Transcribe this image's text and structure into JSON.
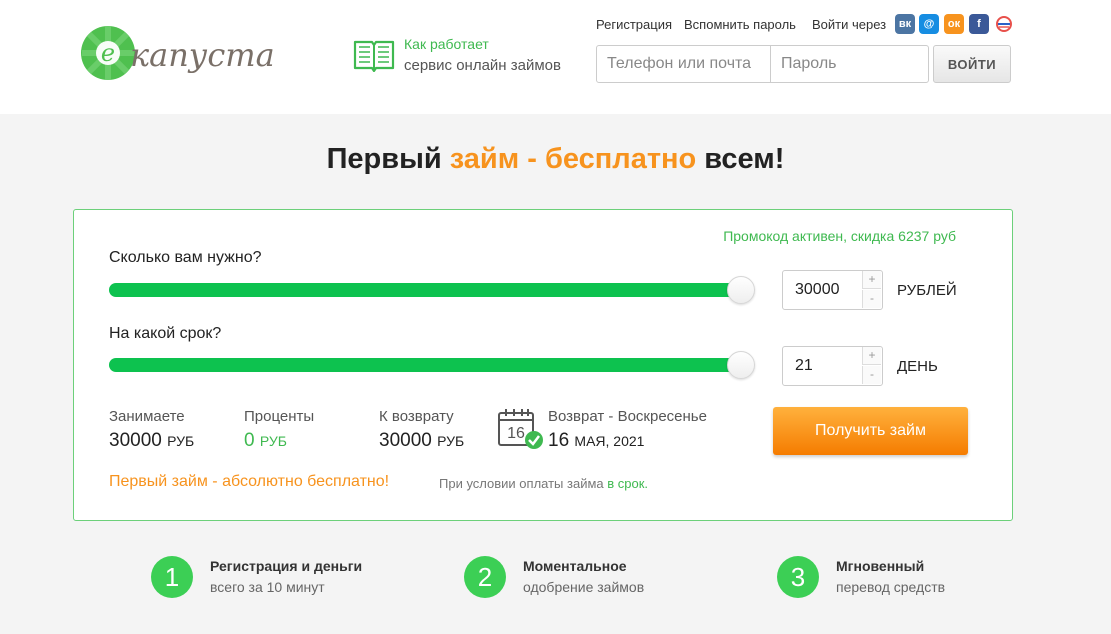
{
  "header": {
    "logo_text": "капуста",
    "how_line1": "Как работает",
    "how_line2": "сервис онлайн займов",
    "links": {
      "register": "Регистрация",
      "remind": "Вспомнить пароль",
      "login_via": "Войти через"
    },
    "social": [
      {
        "name": "vk-icon",
        "glyph": "вк",
        "color": "#4c75a3"
      },
      {
        "name": "mailru-icon",
        "glyph": "@",
        "color": "#168de2"
      },
      {
        "name": "odnoklassniki-icon",
        "glyph": "ок",
        "color": "#f7931e"
      },
      {
        "name": "facebook-icon",
        "glyph": "f",
        "color": "#3b5998"
      },
      {
        "name": "gosuslugi-icon",
        "glyph": "",
        "color": "#ffffff"
      }
    ],
    "login": {
      "phone_placeholder": "Телефон или почта",
      "password_placeholder": "Пароль",
      "button": "ВОЙТИ"
    }
  },
  "hero": {
    "part1": "Первый ",
    "part2": "займ - бесплатно",
    "part3": " всем!"
  },
  "calculator": {
    "promo": "Промокод активен, скидка 6237 руб",
    "amount": {
      "label": "Сколько вам нужно?",
      "value": "30000",
      "unit": "РУБЛЕЙ",
      "level": 1.0
    },
    "term": {
      "label": "На какой срок?",
      "value": "21",
      "unit": "ДЕНЬ",
      "level": 1.0
    },
    "stepper_plus": "+",
    "stepper_minus": "-",
    "summary": {
      "borrow_label": "Занимаете",
      "borrow_value": "30000",
      "borrow_unit": "РУБ",
      "interest_label": "Проценты",
      "interest_value": "0",
      "interest_unit": "РУБ",
      "return_label": "К возврату",
      "return_value": "30000",
      "return_unit": "РУБ",
      "date_label": "Возврат - Воскресенье",
      "date_day": "16",
      "date_rest": "МАЯ, 2021",
      "calendar_day": "16"
    },
    "submit": "Получить займ",
    "free_note": "Первый займ - абсолютно бесплатно!",
    "condition_text": "При условии оплаты займа ",
    "condition_link": "в срок."
  },
  "features": [
    {
      "num": "1",
      "title": "Регистрация и деньги",
      "sub": "всего за 10 минут"
    },
    {
      "num": "2",
      "title": "Моментальное",
      "sub": "одобрение займов"
    },
    {
      "num": "3",
      "title": "Мгновенный",
      "sub": "перевод средств"
    }
  ],
  "colors": {
    "brand_green": "#3fb950",
    "slider_green": "#0dc24f",
    "accent_orange": "#f7931e"
  }
}
